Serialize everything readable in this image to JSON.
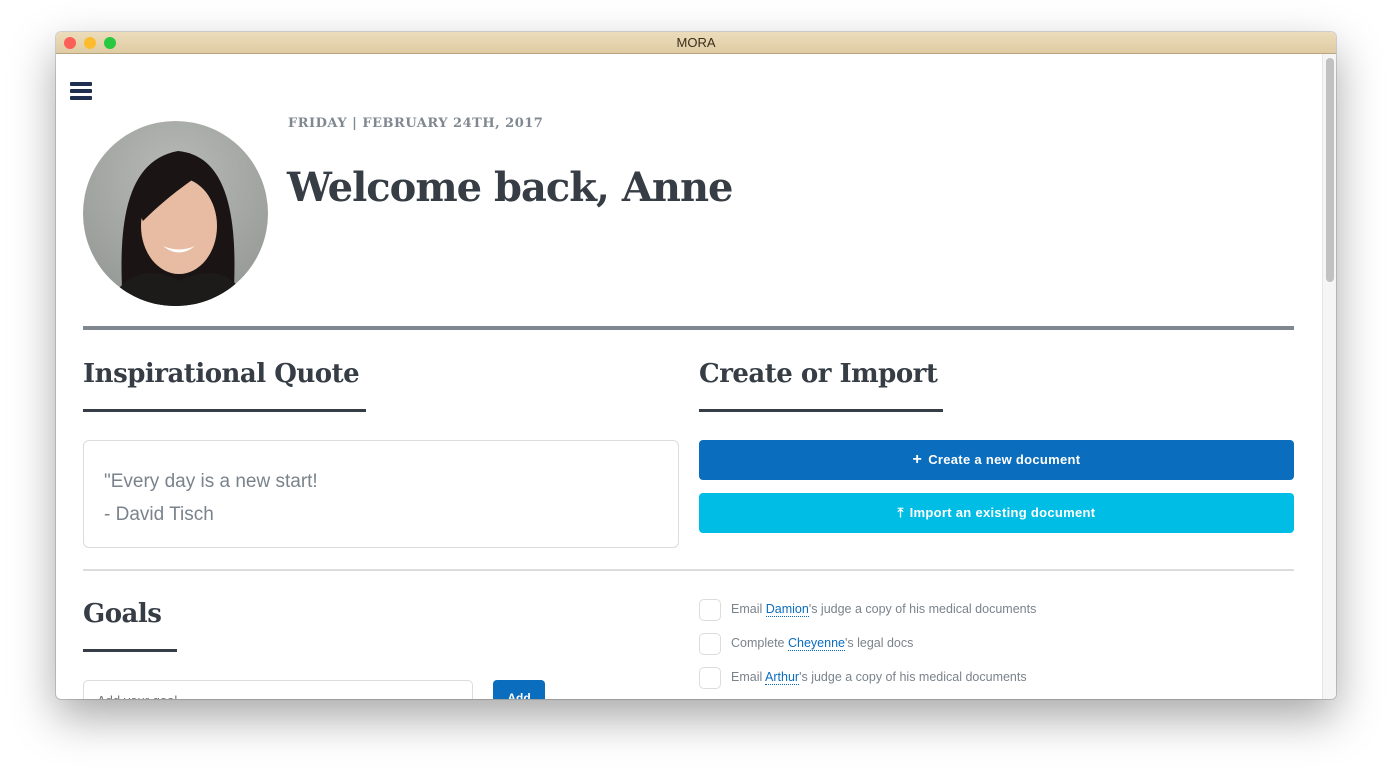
{
  "window": {
    "title": "MORA"
  },
  "header": {
    "date": "FRIDAY | FEBRUARY 24TH, 2017",
    "welcome": "Welcome back, Anne"
  },
  "quote_section": {
    "title": "Inspirational Quote",
    "quote": "\"Every day is a new start!",
    "author": "- David Tisch"
  },
  "create_section": {
    "title": "Create or Import",
    "create_label": "Create a new document",
    "import_label": "Import an existing document"
  },
  "goals": {
    "title": "Goals",
    "placeholder": "Add your goal",
    "add_label": "Add"
  },
  "tasks": [
    {
      "pre": "Email ",
      "name": "Damion",
      "post": "'s judge a copy of his medical documents"
    },
    {
      "pre": "Complete ",
      "name": "Cheyenne",
      "post": "'s legal docs"
    },
    {
      "pre": "Email ",
      "name": "Arthur",
      "post": "'s judge a copy of his medical documents"
    }
  ],
  "colors": {
    "primary": "#0a6dbd",
    "secondary": "#00bde6",
    "text": "#363d45"
  }
}
